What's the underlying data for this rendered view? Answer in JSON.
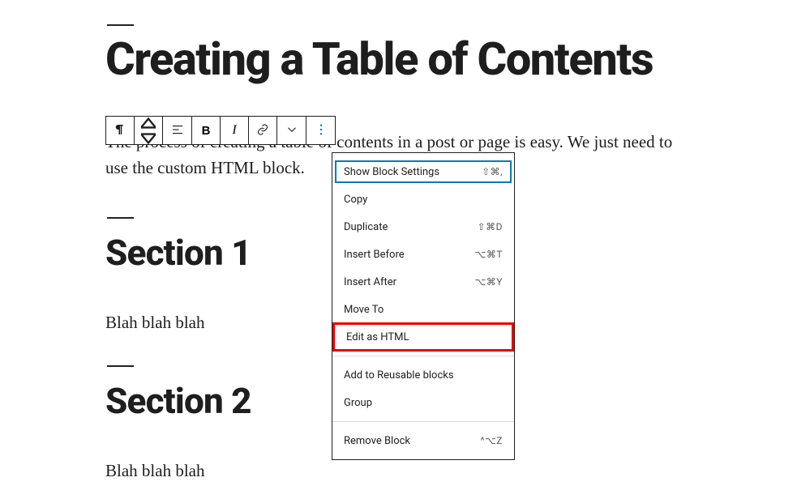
{
  "post": {
    "title": "Creating a Table of Contents",
    "paragraph": "The process of creating a table of contents in a post or page is easy. We just need to use the custom HTML block.",
    "sections": [
      {
        "heading": "Section 1",
        "body": "Blah blah blah"
      },
      {
        "heading": "Section 2",
        "body": "Blah blah blah"
      }
    ]
  },
  "toolbar": {
    "icons": [
      "paragraph",
      "move-updown",
      "align-left",
      "bold",
      "italic",
      "link",
      "chevron-down",
      "more-vertical"
    ]
  },
  "dropdown": {
    "groups": [
      [
        {
          "label": "Show Block Settings",
          "shortcut": "⇧⌘,",
          "focused": true
        },
        {
          "label": "Copy",
          "shortcut": ""
        },
        {
          "label": "Duplicate",
          "shortcut": "⇧⌘D"
        },
        {
          "label": "Insert Before",
          "shortcut": "⌥⌘T"
        },
        {
          "label": "Insert After",
          "shortcut": "⌥⌘Y"
        },
        {
          "label": "Move To",
          "shortcut": ""
        },
        {
          "label": "Edit as HTML",
          "shortcut": "",
          "highlighted": true
        }
      ],
      [
        {
          "label": "Add to Reusable blocks",
          "shortcut": ""
        },
        {
          "label": "Group",
          "shortcut": ""
        }
      ],
      [
        {
          "label": "Remove Block",
          "shortcut": "^⌥Z"
        }
      ]
    ]
  }
}
